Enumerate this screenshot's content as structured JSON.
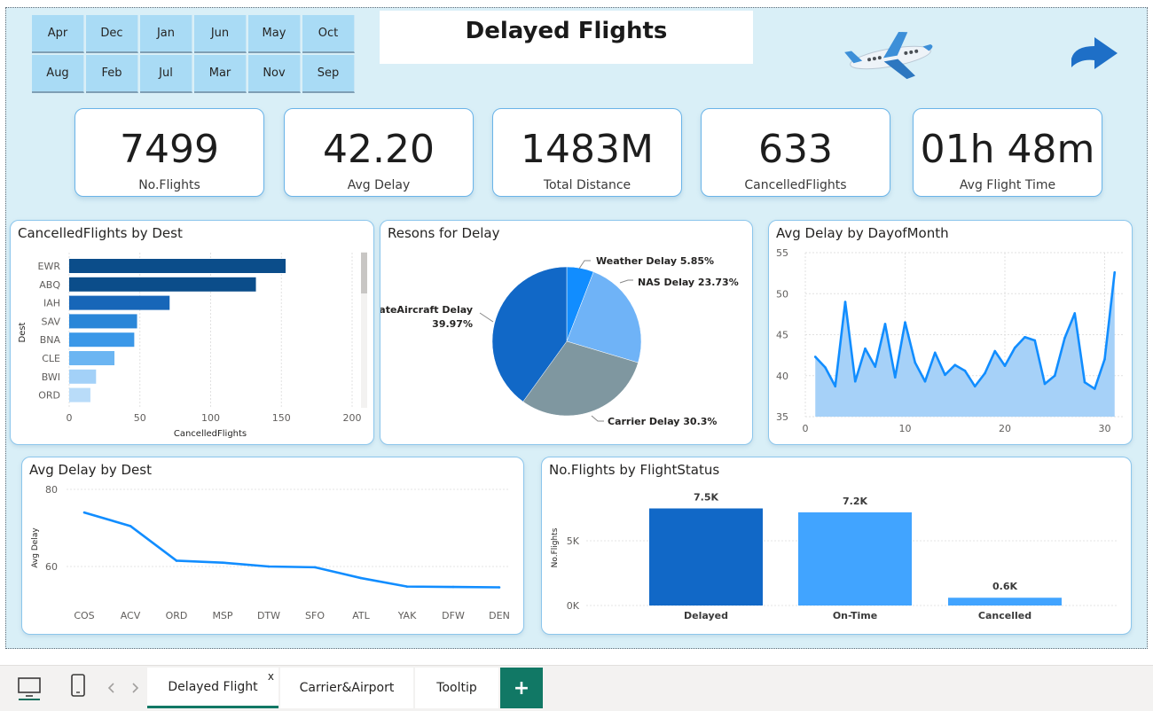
{
  "header": {
    "title": "Delayed Flights"
  },
  "month_slicer": {
    "items": [
      "Apr",
      "Dec",
      "Jan",
      "Jun",
      "May",
      "Oct",
      "Aug",
      "Feb",
      "Jul",
      "Mar",
      "Nov",
      "Sep"
    ]
  },
  "kpis": [
    {
      "value": "7499",
      "label": "No.Flights"
    },
    {
      "value": "42.20",
      "label": "Avg Delay"
    },
    {
      "value": "1483M",
      "label": "Total Distance"
    },
    {
      "value": "633",
      "label": "CancelledFlights"
    },
    {
      "value": "01h 48m",
      "label": "Avg Flight Time"
    }
  ],
  "icons": {
    "plane": "airplane-icon",
    "next": "arrow-right-icon"
  },
  "colors": {
    "dark_blue": "#0d4f8b",
    "mid_blue": "#118dff",
    "light_blue": "#a6d4fb",
    "gray": "#7f97a0",
    "accent": "#2b88d8"
  },
  "chart_data": [
    {
      "id": "cancelled",
      "type": "bar",
      "orientation": "horizontal",
      "title": "CancelledFlights by Dest",
      "xlabel": "CancelledFlights",
      "ylabel": "Dest",
      "categories": [
        "EWR",
        "ABQ",
        "IAH",
        "SAV",
        "BNA",
        "CLE",
        "BWI",
        "ORD"
      ],
      "values": [
        153,
        132,
        71,
        48,
        46,
        32,
        19,
        15
      ],
      "xlim": [
        0,
        200
      ],
      "xticks": [
        "0",
        "50",
        "100",
        "150",
        "200"
      ]
    },
    {
      "id": "reasons",
      "type": "pie",
      "title": "Resons for Delay",
      "slices": [
        {
          "label": "Weather Delay",
          "value": 5.85,
          "display": "Weather Delay 5.85%"
        },
        {
          "label": "NAS Delay",
          "value": 23.73,
          "display": "NAS Delay 23.73%"
        },
        {
          "label": "Carrier Delay",
          "value": 30.3,
          "display": "Carrier Delay 30.3%"
        },
        {
          "label": "LateAircraft Delay",
          "value": 39.97,
          "display": "LateAircraft Delay",
          "display2": "39.97%"
        }
      ]
    },
    {
      "id": "dayofmonth",
      "type": "area",
      "title": "Avg Delay by DayofMonth",
      "x": [
        1,
        2,
        3,
        4,
        5,
        6,
        7,
        8,
        9,
        10,
        11,
        12,
        13,
        14,
        15,
        16,
        17,
        18,
        19,
        20,
        21,
        22,
        23,
        24,
        25,
        26,
        27,
        28,
        29,
        30,
        31
      ],
      "values": [
        42.3,
        41.0,
        38.7,
        49.0,
        39.3,
        43.3,
        41.1,
        46.3,
        39.8,
        46.5,
        41.6,
        39.3,
        42.8,
        40.1,
        41.3,
        40.6,
        38.7,
        40.3,
        43.0,
        41.2,
        43.4,
        44.7,
        44.3,
        39.0,
        40.0,
        44.6,
        47.6,
        39.2,
        38.4,
        42.0,
        52.6
      ],
      "ylim": [
        35,
        55
      ],
      "yticks": [
        "35",
        "40",
        "45",
        "50",
        "55"
      ],
      "xticks": [
        "0",
        "10",
        "20",
        "30"
      ]
    },
    {
      "id": "avgdelaydest",
      "type": "line",
      "title": "Avg Delay by Dest",
      "ylabel": "Avg Delay",
      "categories": [
        "COS",
        "ACV",
        "ORD",
        "MSP",
        "DTW",
        "SFO",
        "ATL",
        "YAK",
        "DFW",
        "DEN"
      ],
      "values": [
        74.0,
        70.5,
        61.5,
        61.0,
        60.0,
        59.8,
        57.0,
        54.8,
        54.7,
        54.6
      ],
      "ylim": [
        50,
        80
      ],
      "yticks": [
        "60",
        "80"
      ]
    },
    {
      "id": "flightstatus",
      "type": "bar",
      "title": "No.Flights by FlightStatus",
      "ylabel": "No.Flights",
      "categories": [
        "Delayed",
        "On-Time",
        "Cancelled"
      ],
      "values": [
        7500,
        7200,
        600
      ],
      "data_labels": [
        "7.5K",
        "7.2K",
        "0.6K"
      ],
      "ylim": [
        0,
        9000
      ],
      "yticks": [
        "0K",
        "5K"
      ]
    }
  ],
  "footer": {
    "tabs": [
      "Delayed Flight",
      "Carrier&Airport",
      "Tooltip"
    ],
    "close_glyph": "x",
    "add_glyph": "+"
  }
}
